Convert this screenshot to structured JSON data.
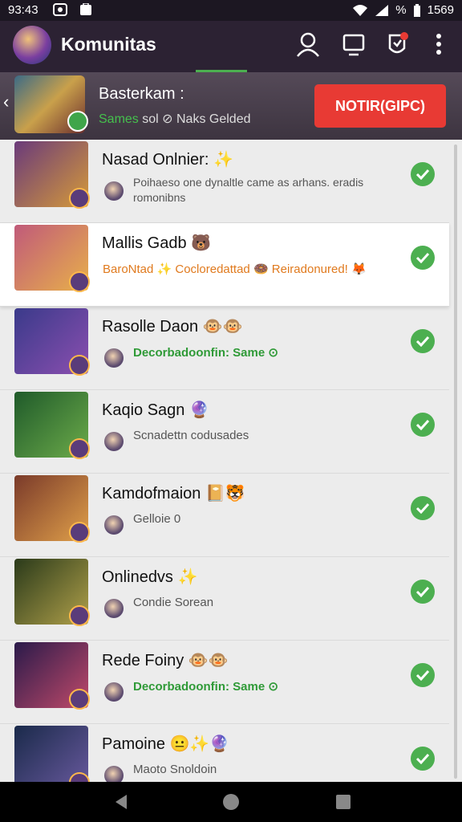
{
  "status": {
    "time": "93:43",
    "battery": "% ",
    "clock": "1569"
  },
  "app": {
    "title": "Komunitas"
  },
  "banner": {
    "title": "Basterkam :",
    "sub_green": "Sames",
    "sub_rest": " sol ⊘ Naks Gelded",
    "button": "NOTIR(GIPC)"
  },
  "rows": [
    {
      "name": "Nasad Onlnier: ✨",
      "sub": "Poihaeso one dynaltle came as arhans. eradis romonibns",
      "style": "plain",
      "thumb_colors": [
        "#6a3a7a",
        "#d59a3a"
      ]
    },
    {
      "name": "Mallis Gadb 🐻",
      "sub": "BaroNtad ✨ Cocloredattad 🍩 Reiradonured! 🦊",
      "style": "orange",
      "thumb_colors": [
        "#c05a7a",
        "#e8b04a"
      ]
    },
    {
      "name": "Rasolle Daon 🐵🐵",
      "sub": "Decorbadoonfin: Same ⊙",
      "style": "green",
      "thumb_colors": [
        "#3a3a8a",
        "#8b4fb0"
      ]
    },
    {
      "name": "Kaqio Sagn 🔮",
      "sub": "Scnadettn codusades",
      "style": "plain",
      "thumb_colors": [
        "#1f5a2a",
        "#6cab4a"
      ]
    },
    {
      "name": "Kamdofmaion 📔🐯",
      "sub": "Gelloie 0",
      "style": "plain",
      "thumb_colors": [
        "#7a3a2a",
        "#e0a04a"
      ]
    },
    {
      "name": "Onlinedvs ✨",
      "sub": "Condie Sorean",
      "style": "plain",
      "thumb_colors": [
        "#2a3a1a",
        "#b0a04a"
      ]
    },
    {
      "name": "Rede Foiny 🐵🐵",
      "sub": "Decorbadoonfin: Same ⊙",
      "style": "green",
      "thumb_colors": [
        "#2a1a4a",
        "#c04a6a"
      ]
    },
    {
      "name": "Pamoine 😐✨🔮",
      "sub": "Maoto Snoldoin",
      "style": "plain",
      "thumb_colors": [
        "#1a2a4a",
        "#6a5aa0"
      ]
    }
  ],
  "colors": {
    "accent": "#4caf50",
    "button": "#e83a34",
    "appbar": "#2c2233"
  }
}
